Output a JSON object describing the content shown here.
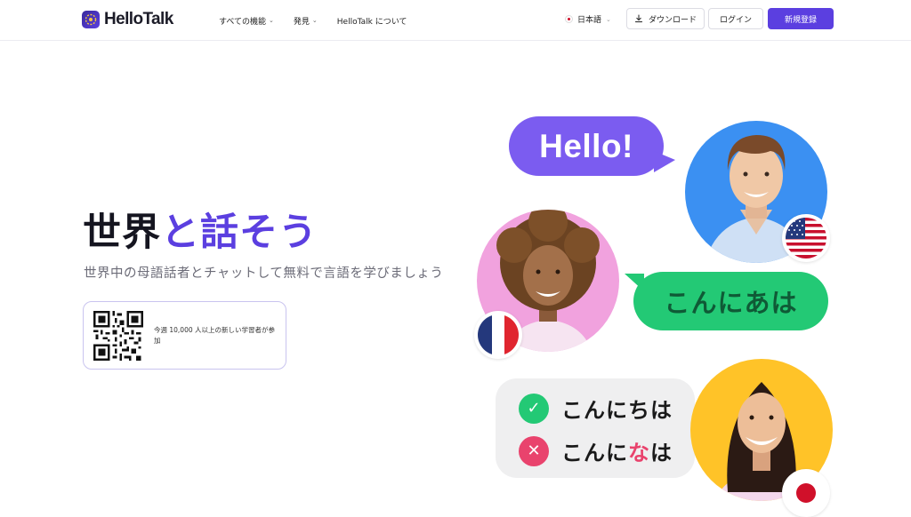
{
  "header": {
    "logo_text": "HelloTalk",
    "nav": [
      {
        "label": "すべての機能",
        "has_dropdown": true
      },
      {
        "label": "発見",
        "has_dropdown": true
      },
      {
        "label": "HelloTalk について",
        "has_dropdown": false
      }
    ],
    "language": {
      "label": "日本語",
      "flag": "japan-flag-icon"
    },
    "download_label": "ダウンロード",
    "login_label": "ログイン",
    "signup_label": "新規登録"
  },
  "hero": {
    "title_part1": "世界",
    "title_part2": "と話そう",
    "subtitle": "世界中の母語話者とチャットして無料で言語を学びましょう",
    "qr_text": "今週 10,000 人以上の新しい学習者が参加"
  },
  "illustration": {
    "bubble_hello": "Hello!",
    "bubble_wrong_greeting": "こんにあは",
    "quiz_correct": "こんにちは",
    "quiz_wrong_prefix": "こんに",
    "quiz_wrong_char": "な",
    "quiz_wrong_suffix": "は",
    "flags": [
      "usa-flag-icon",
      "france-flag-icon",
      "japan-flag-icon"
    ]
  },
  "colors": {
    "brand_purple": "#5b3fe0",
    "hello_bubble": "#7b5cf0",
    "green_bubble": "#23c975",
    "error_pink": "#e9436d",
    "avatar_blue": "#3b90f2",
    "avatar_pink": "#f1a2de",
    "avatar_yellow": "#ffc328"
  }
}
